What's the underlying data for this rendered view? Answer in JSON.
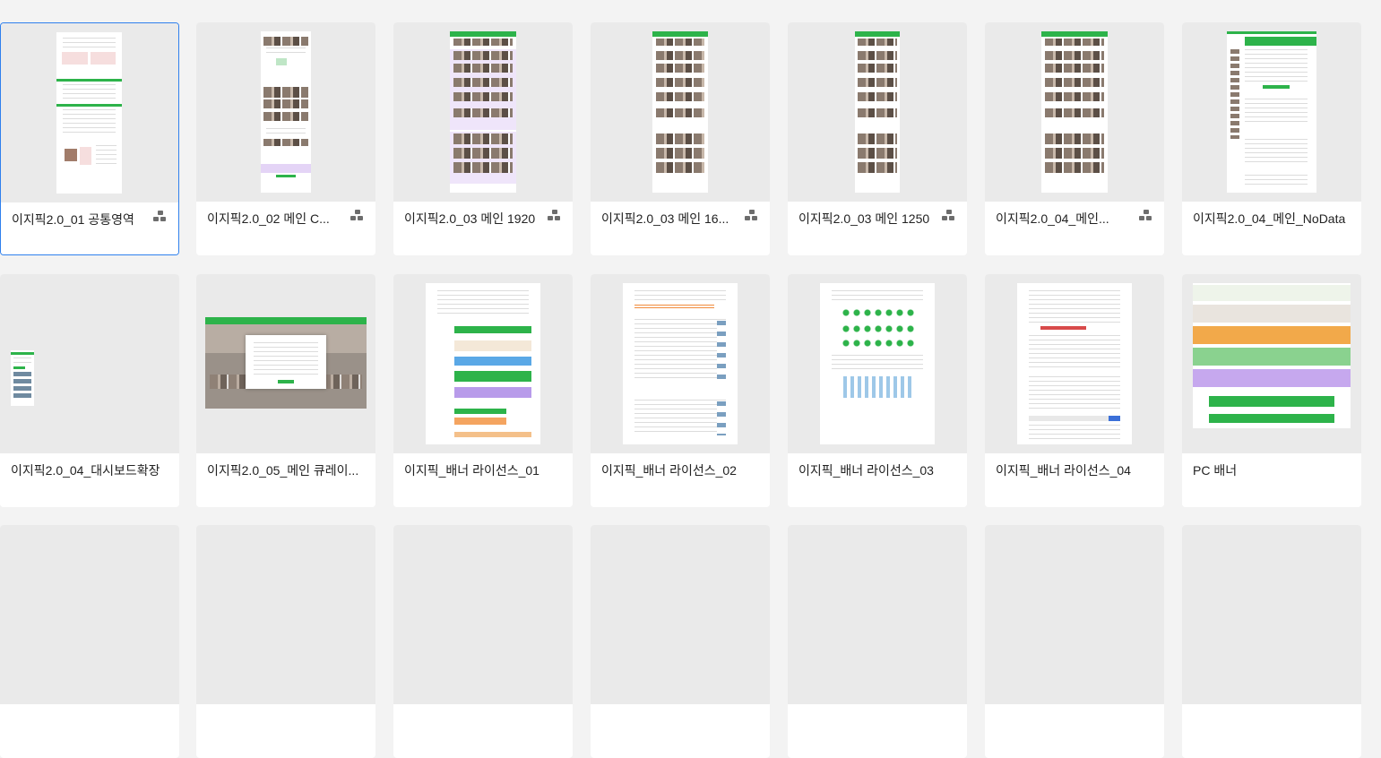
{
  "cards": [
    {
      "title": "이지픽2.0_01 공통영역",
      "has_component_icon": true,
      "selected": true
    },
    {
      "title": "이지픽2.0_02 메인 C...",
      "has_component_icon": true
    },
    {
      "title": "이지픽2.0_03 메인 1920",
      "has_component_icon": true
    },
    {
      "title": "이지픽2.0_03 메인 16...",
      "has_component_icon": true
    },
    {
      "title": "이지픽2.0_03 메인 1250",
      "has_component_icon": true
    },
    {
      "title": "이지픽2.0_04_메인...",
      "has_component_icon": true
    },
    {
      "title": "이지픽2.0_04_메인_NoData",
      "has_component_icon": false
    },
    {
      "title": "이지픽2.0_04_대시보드확장",
      "has_component_icon": false
    },
    {
      "title": "이지픽2.0_05_메인 큐레이...",
      "has_component_icon": false
    },
    {
      "title": "이지픽_배너 라이선스_01",
      "has_component_icon": false
    },
    {
      "title": "이지픽_배너 라이선스_02",
      "has_component_icon": false
    },
    {
      "title": "이지픽_배너 라이선스_03",
      "has_component_icon": false
    },
    {
      "title": "이지픽_배너 라이선스_04",
      "has_component_icon": false
    },
    {
      "title": "PC 배너",
      "has_component_icon": false
    }
  ],
  "colors": {
    "selected_border": "#2f80ed",
    "accent_green": "#2db34a",
    "purple": "#e4d4f6"
  }
}
